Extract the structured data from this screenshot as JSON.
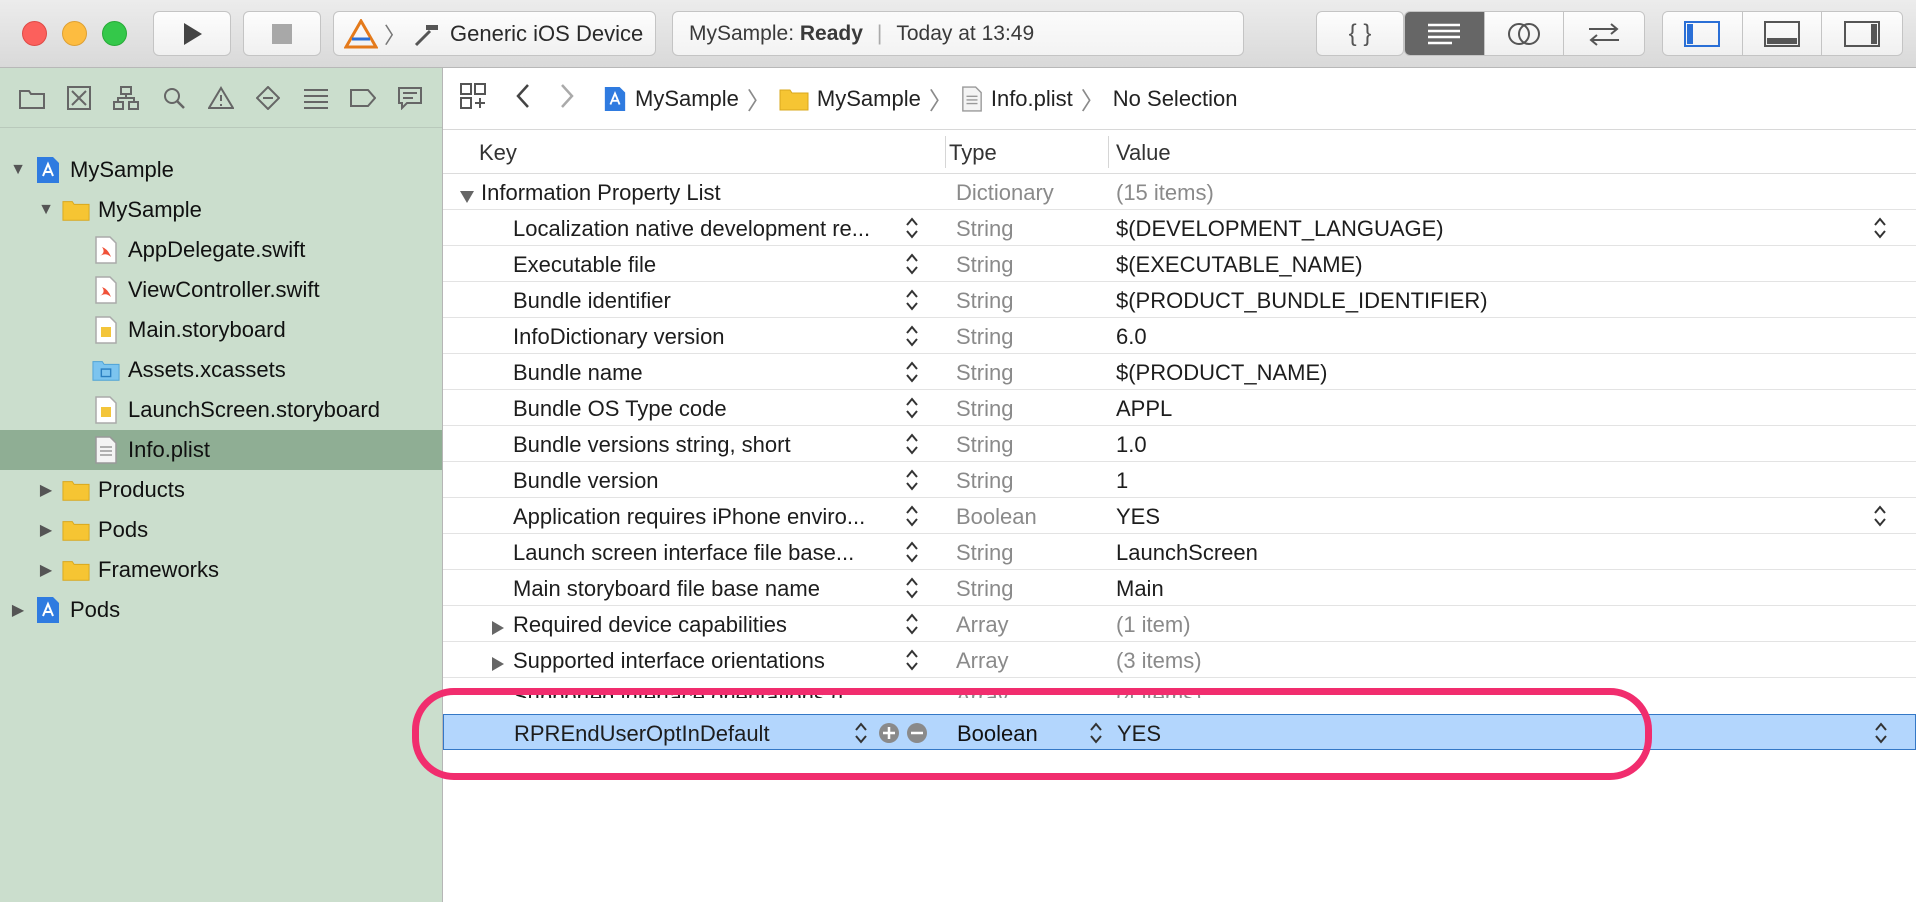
{
  "scheme": {
    "target": "Generic iOS Device"
  },
  "activity": {
    "project": "MySample:",
    "status": "Ready",
    "time": "Today at 13:49"
  },
  "toolbar": {
    "editor_braces": "{ }"
  },
  "navigator": {
    "items": [
      {
        "label": "MySample"
      },
      {
        "label": "MySample"
      },
      {
        "label": "AppDelegate.swift"
      },
      {
        "label": "ViewController.swift"
      },
      {
        "label": "Main.storyboard"
      },
      {
        "label": "Assets.xcassets"
      },
      {
        "label": "LaunchScreen.storyboard"
      },
      {
        "label": "Info.plist"
      },
      {
        "label": "Products"
      },
      {
        "label": "Pods"
      },
      {
        "label": "Frameworks"
      },
      {
        "label": "Pods"
      }
    ]
  },
  "jumpbar": {
    "crumbs": [
      "MySample",
      "MySample",
      "Info.plist",
      "No Selection"
    ]
  },
  "plist": {
    "columns": {
      "key": "Key",
      "type": "Type",
      "value": "Value"
    },
    "root": {
      "key": "Information Property List",
      "type": "Dictionary",
      "value": "(15 items)"
    },
    "rows": [
      {
        "key": "Localization native development re...",
        "type": "String",
        "value": "$(DEVELOPMENT_LANGUAGE)"
      },
      {
        "key": "Executable file",
        "type": "String",
        "value": "$(EXECUTABLE_NAME)"
      },
      {
        "key": "Bundle identifier",
        "type": "String",
        "value": "$(PRODUCT_BUNDLE_IDENTIFIER)"
      },
      {
        "key": "InfoDictionary version",
        "type": "String",
        "value": "6.0"
      },
      {
        "key": "Bundle name",
        "type": "String",
        "value": "$(PRODUCT_NAME)"
      },
      {
        "key": "Bundle OS Type code",
        "type": "String",
        "value": "APPL"
      },
      {
        "key": "Bundle versions string, short",
        "type": "String",
        "value": "1.0"
      },
      {
        "key": "Bundle version",
        "type": "String",
        "value": "1"
      },
      {
        "key": "Application requires iPhone enviro...",
        "type": "Boolean",
        "value": "YES"
      },
      {
        "key": "Launch screen interface file base...",
        "type": "String",
        "value": "LaunchScreen"
      },
      {
        "key": "Main storyboard file base name",
        "type": "String",
        "value": "Main"
      },
      {
        "key": "Required device capabilities",
        "type": "Array",
        "value": "(1 item)"
      },
      {
        "key": "Supported interface orientations",
        "type": "Array",
        "value": "(3 items)"
      },
      {
        "key": "Supported interface orientations (i...",
        "type": "Array",
        "value": "(4 items)"
      },
      {
        "key": "RPREndUserOptInDefault",
        "type": "Boolean",
        "value": "YES"
      }
    ]
  },
  "colors": {
    "accent_highlight": "#f12d6e",
    "selection": "#b3d6fd",
    "navigator_bg": "#cbdecd"
  }
}
